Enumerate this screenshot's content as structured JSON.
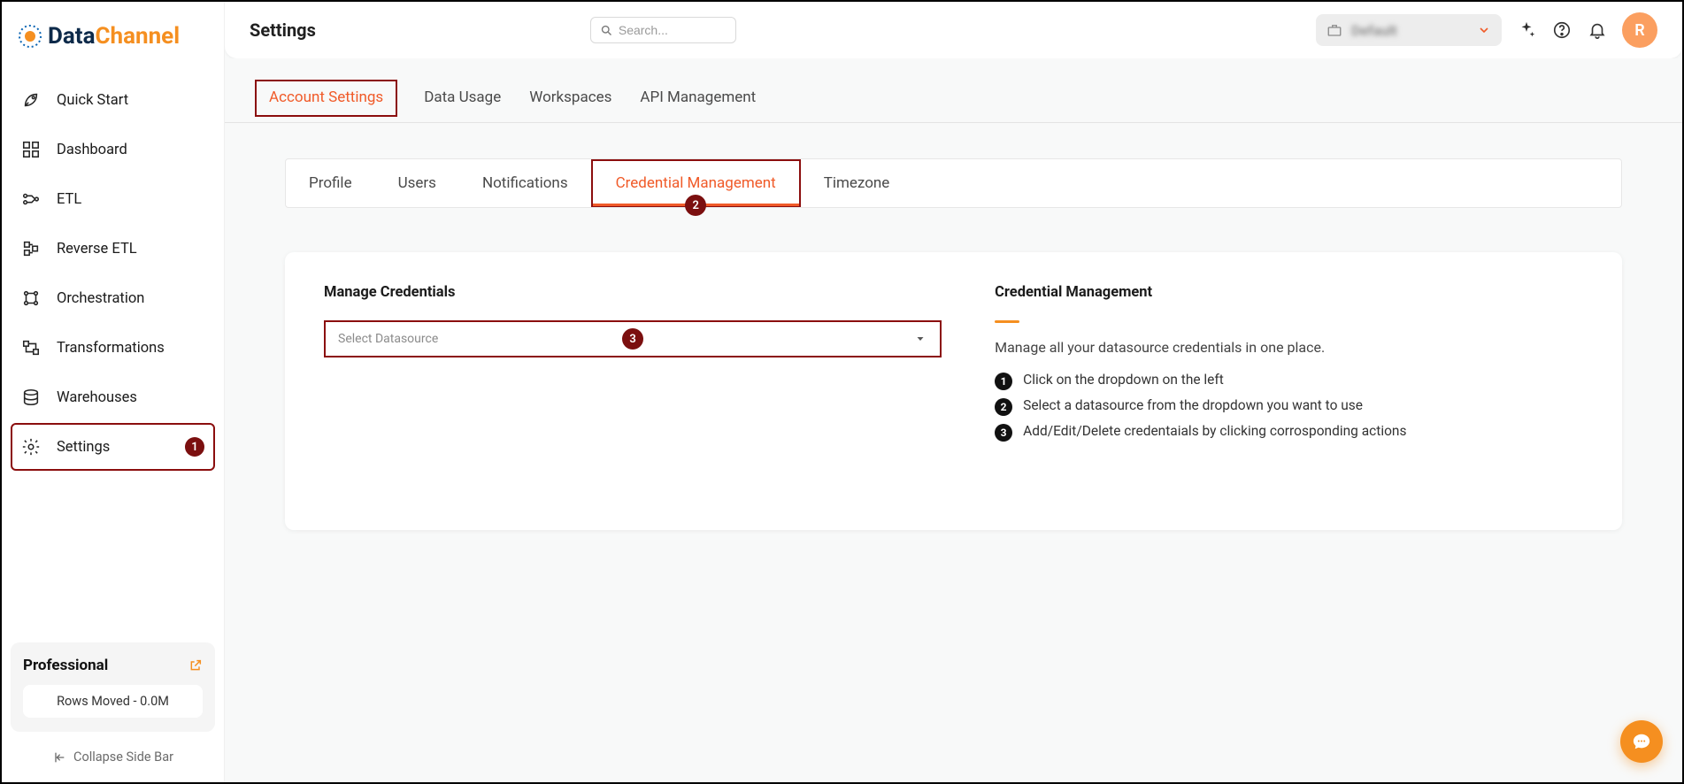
{
  "logo": {
    "brand1": "Data",
    "brand2": "Channel"
  },
  "sidebar": {
    "items": [
      {
        "label": "Quick Start"
      },
      {
        "label": "Dashboard"
      },
      {
        "label": "ETL"
      },
      {
        "label": "Reverse ETL"
      },
      {
        "label": "Orchestration"
      },
      {
        "label": "Transformations"
      },
      {
        "label": "Warehouses"
      },
      {
        "label": "Settings"
      }
    ],
    "plan": "Professional",
    "rows_moved": "Rows Moved - 0.0M",
    "collapse": "Collapse Side Bar"
  },
  "topbar": {
    "title": "Settings",
    "search_placeholder": "Search...",
    "workspace_label": "Default",
    "avatar": "R"
  },
  "tabs": {
    "list": [
      {
        "label": "Account Settings"
      },
      {
        "label": "Data Usage"
      },
      {
        "label": "Workspaces"
      },
      {
        "label": "API Management"
      }
    ]
  },
  "subtabs": {
    "list": [
      {
        "label": "Profile"
      },
      {
        "label": "Users"
      },
      {
        "label": "Notifications"
      },
      {
        "label": "Credential Management"
      },
      {
        "label": "Timezone"
      }
    ]
  },
  "content": {
    "left_title": "Manage Credentials",
    "select_placeholder": "Select Datasource",
    "right_title": "Credential Management",
    "right_desc": "Manage all your datasource credentials in one place.",
    "steps": [
      "Click on the dropdown on the left",
      "Select a datasource from the dropdown you want to use",
      "Add/Edit/Delete credentaials by clicking corrosponding actions"
    ]
  },
  "annotations": {
    "a1": "1",
    "a2": "2",
    "a3": "3"
  }
}
